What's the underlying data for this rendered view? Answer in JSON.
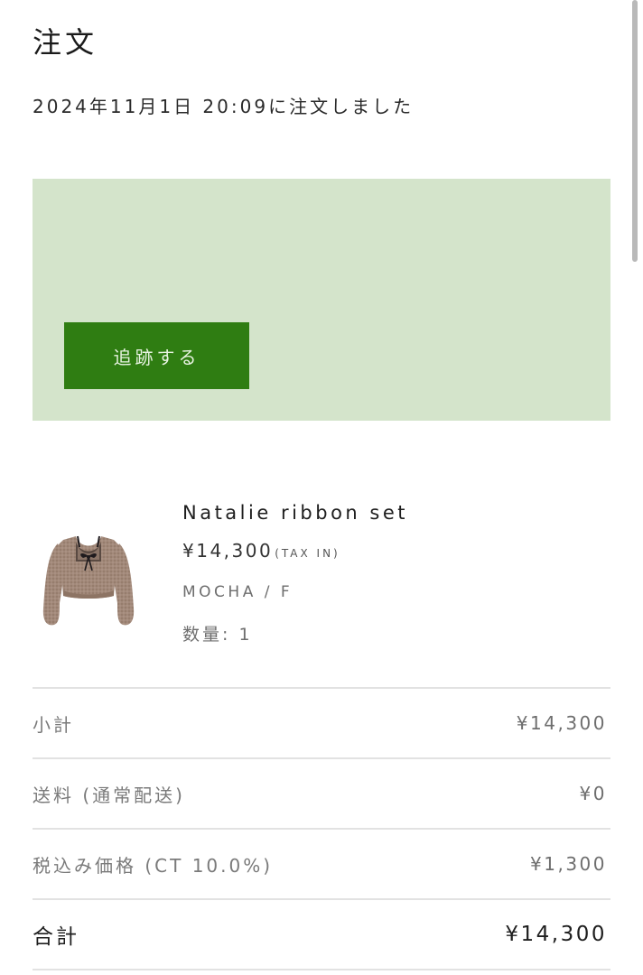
{
  "header": {
    "title": "注文",
    "order_date": "2024年11月1日 20:09に注文しました"
  },
  "tracking": {
    "button_label": "追跡する",
    "panel_color": "#d4e4cb",
    "button_color": "#2f7d12"
  },
  "product": {
    "name": "Natalie ribbon set",
    "price": "¥14,300",
    "tax_note": "(TAX IN)",
    "variant": "MOCHA / F",
    "quantity": "数量: 1",
    "thumbnail_icon": "cardigan-image"
  },
  "summary": {
    "subtotal_label": "小計",
    "subtotal_value": "¥14,300",
    "shipping_label": "送料 (通常配送)",
    "shipping_value": "¥0",
    "tax_label": "税込み価格 (CT 10.0%)",
    "tax_value": "¥1,300",
    "total_label": "合計",
    "total_value": "¥14,300"
  }
}
